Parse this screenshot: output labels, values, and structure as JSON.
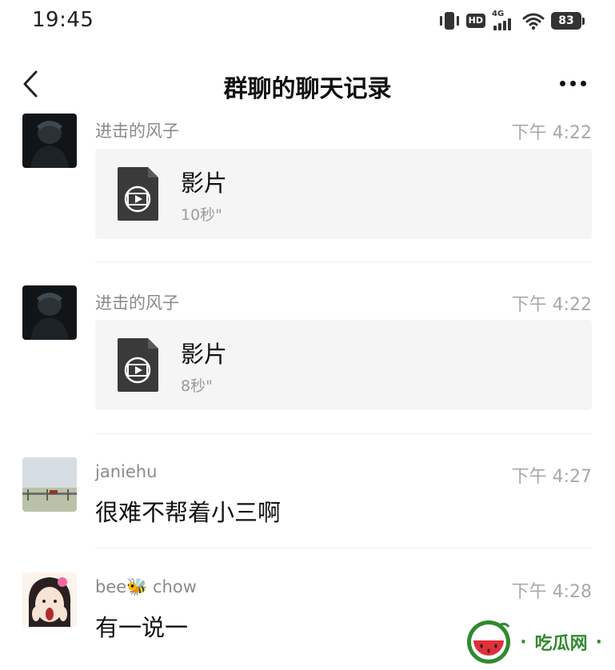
{
  "status_bar": {
    "time": "19:45",
    "network_type": "4G",
    "hd_label": "HD",
    "battery": "83",
    "icons": [
      "vibrate-icon",
      "hd-icon",
      "signal-icon",
      "wifi-icon",
      "battery-icon"
    ]
  },
  "nav": {
    "title": "群聊的聊天记录",
    "back_icon": "chevron-left-icon",
    "more_icon": "more-dots-icon"
  },
  "messages": [
    {
      "sender": "进击的风子",
      "time": "下午 4:22",
      "type": "video",
      "video_title": "影片",
      "duration": "10秒\""
    },
    {
      "sender": "进击的风子",
      "time": "下午 4:22",
      "type": "video",
      "video_title": "影片",
      "duration": "8秒\""
    },
    {
      "sender": "janiehu",
      "time": "下午 4:27",
      "type": "text",
      "text": "很难不帮着小三啊"
    },
    {
      "sender_prefix": "bee",
      "sender_suffix": "chow",
      "sender_emoji": "🐝",
      "time": "下午 4:28",
      "type": "text",
      "text": "有一说一"
    }
  ],
  "watermark": {
    "text": "吃瓜网",
    "dot": "·",
    "colors": {
      "green": "#2f8a2f",
      "red": "#e0303a"
    }
  }
}
